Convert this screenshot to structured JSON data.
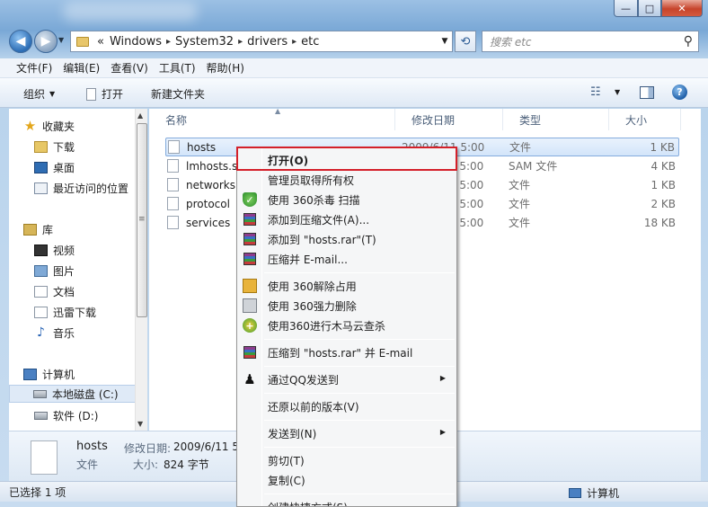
{
  "window": {
    "buttons": {
      "minimize": "—",
      "maximize": "□",
      "close": "✕"
    }
  },
  "address": {
    "prefix": "«",
    "segments": [
      "Windows",
      "System32",
      "drivers",
      "etc"
    ],
    "search_placeholder": "搜索 etc"
  },
  "menubar": {
    "items": [
      "文件(F)",
      "编辑(E)",
      "查看(V)",
      "工具(T)",
      "帮助(H)"
    ]
  },
  "toolbar": {
    "organize": "组织",
    "open": "打开",
    "new_folder": "新建文件夹"
  },
  "nav": {
    "favorites": "收藏夹",
    "downloads": "下载",
    "desktop": "桌面",
    "recent": "最近访问的位置",
    "libraries": "库",
    "videos": "视频",
    "pictures": "图片",
    "documents": "文档",
    "xunlei": "迅雷下载",
    "music": "音乐",
    "computer": "计算机",
    "drive_c": "本地磁盘 (C:)",
    "drive_d": "软件 (D:)"
  },
  "columns": {
    "name": "名称",
    "date": "修改日期",
    "type": "类型",
    "size": "大小"
  },
  "files": [
    {
      "name": "hosts",
      "date": "2009/6/11 5:00",
      "type": "文件",
      "size": "1 KB"
    },
    {
      "name": "lmhosts.sam",
      "date": "2009/6/11 5:00",
      "type": "SAM 文件",
      "size": "4 KB"
    },
    {
      "name": "networks",
      "date": "2009/6/11 5:00",
      "type": "文件",
      "size": "1 KB"
    },
    {
      "name": "protocol",
      "date": "2009/6/11 5:00",
      "type": "文件",
      "size": "2 KB"
    },
    {
      "name": "services",
      "date": "2009/6/11 5:00",
      "type": "文件",
      "size": "18 KB"
    }
  ],
  "details": {
    "name": "hosts",
    "date_label": "修改日期:",
    "date": "2009/6/11 5:00",
    "type": "文件",
    "size_label": "大小:",
    "size": "824 字节"
  },
  "status": {
    "selected": "已选择 1 项",
    "location": "计算机"
  },
  "context_menu": {
    "open": "打开(O)",
    "take_ownership": "管理员取得所有权",
    "scan_360": "使用 360杀毒 扫描",
    "add_archive": "添加到压缩文件(A)...",
    "add_hosts_rar": "添加到 \"hosts.rar\"(T)",
    "compress_email": "压缩并 E-mail...",
    "unlock_360": "使用 360解除占用",
    "force_delete_360": "使用 360强力删除",
    "cloud_scan_360": "使用360进行木马云查杀",
    "compress_rar_email": "压缩到 \"hosts.rar\" 并 E-mail",
    "send_via_qq": "通过QQ发送到",
    "restore_versions": "还原以前的版本(V)",
    "send_to": "发送到(N)",
    "cut": "剪切(T)",
    "copy": "复制(C)",
    "create_shortcut": "创建快捷方式(S)"
  }
}
